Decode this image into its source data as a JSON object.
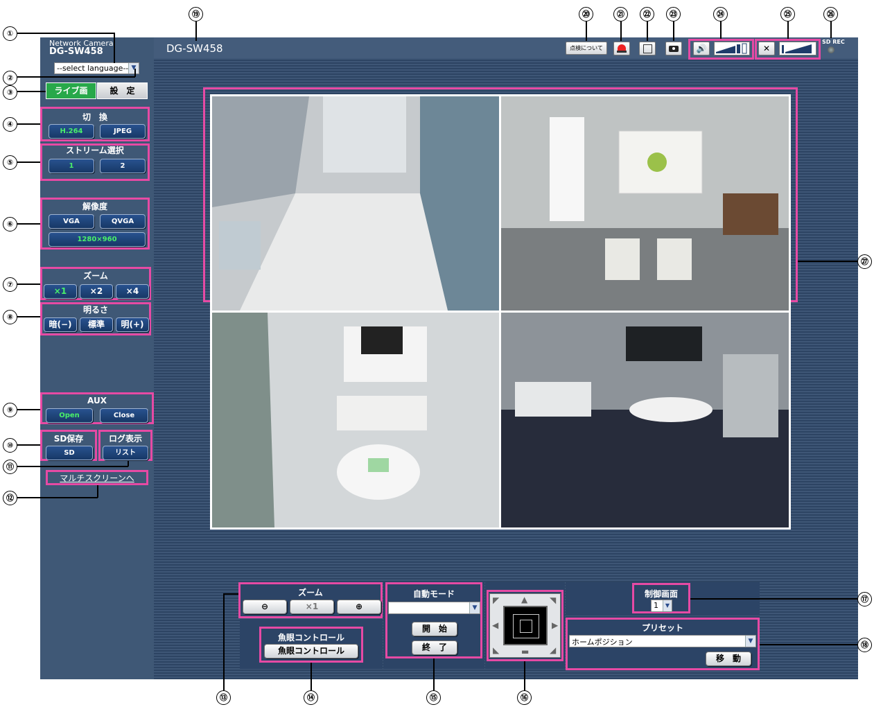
{
  "callouts": {
    "c1": "①",
    "c2": "②",
    "c3": "③",
    "c4": "④",
    "c5": "⑤",
    "c6": "⑥",
    "c7": "⑦",
    "c8": "⑧",
    "c9": "⑨",
    "c10": "⑩",
    "c11": "⑪",
    "c12": "⑫",
    "c13": "⑬",
    "c14": "⑭",
    "c15": "⑮",
    "c16": "⑯",
    "c17": "⑰",
    "c18": "⑱",
    "c19": "⑲",
    "c20": "⑳",
    "c21": "㉑",
    "c22": "㉒",
    "c23": "㉓",
    "c24": "㉔",
    "c25": "㉕",
    "c26": "㉖",
    "c27": "㉗"
  },
  "header": {
    "product_line": "Network Camera",
    "model": "DG-SW458",
    "camera_title": "DG-SW458",
    "inspection_label": "点検について",
    "sd_rec_label": "SD REC"
  },
  "language": {
    "selected": "--select language--"
  },
  "tabs": {
    "live": "ライブ画",
    "setup": "設　定"
  },
  "switch": {
    "title": "切　換",
    "h264": "H.264",
    "jpeg": "JPEG"
  },
  "stream": {
    "title": "ストリーム選択",
    "s1": "1",
    "s2": "2"
  },
  "resolution": {
    "title": "解像度",
    "vga": "VGA",
    "qvga": "QVGA",
    "hd": "1280×960"
  },
  "zoom_side": {
    "title": "ズーム",
    "x1": "×1",
    "x2": "×2",
    "x4": "×4"
  },
  "brightness": {
    "title": "明るさ",
    "dark": "暗(−)",
    "normal": "標準",
    "bright": "明(+)"
  },
  "aux": {
    "title": "AUX",
    "open": "Open",
    "close": "Close"
  },
  "sd_save": {
    "title": "SD保存",
    "btn": "SD"
  },
  "log": {
    "title": "ログ表示",
    "btn": "リスト"
  },
  "multiscreen_link": "マルチスクリーンへ",
  "ptz": {
    "zoom_title": "ズーム",
    "zoom_reset": "×1",
    "fisheye_title": "魚眼コントロール",
    "fisheye_btn": "魚眼コントロール",
    "auto_title": "自動モード",
    "auto_selected": "",
    "start": "開　始",
    "end": "終　了",
    "control_title": "制御画面",
    "control_selected": "1",
    "preset_title": "プリセット",
    "preset_selected": "ホームポジション",
    "move": "移　動"
  },
  "colors": {
    "highlight": "#e64aa4",
    "sidebar": "#3f5876",
    "active_text": "#49f06a"
  }
}
